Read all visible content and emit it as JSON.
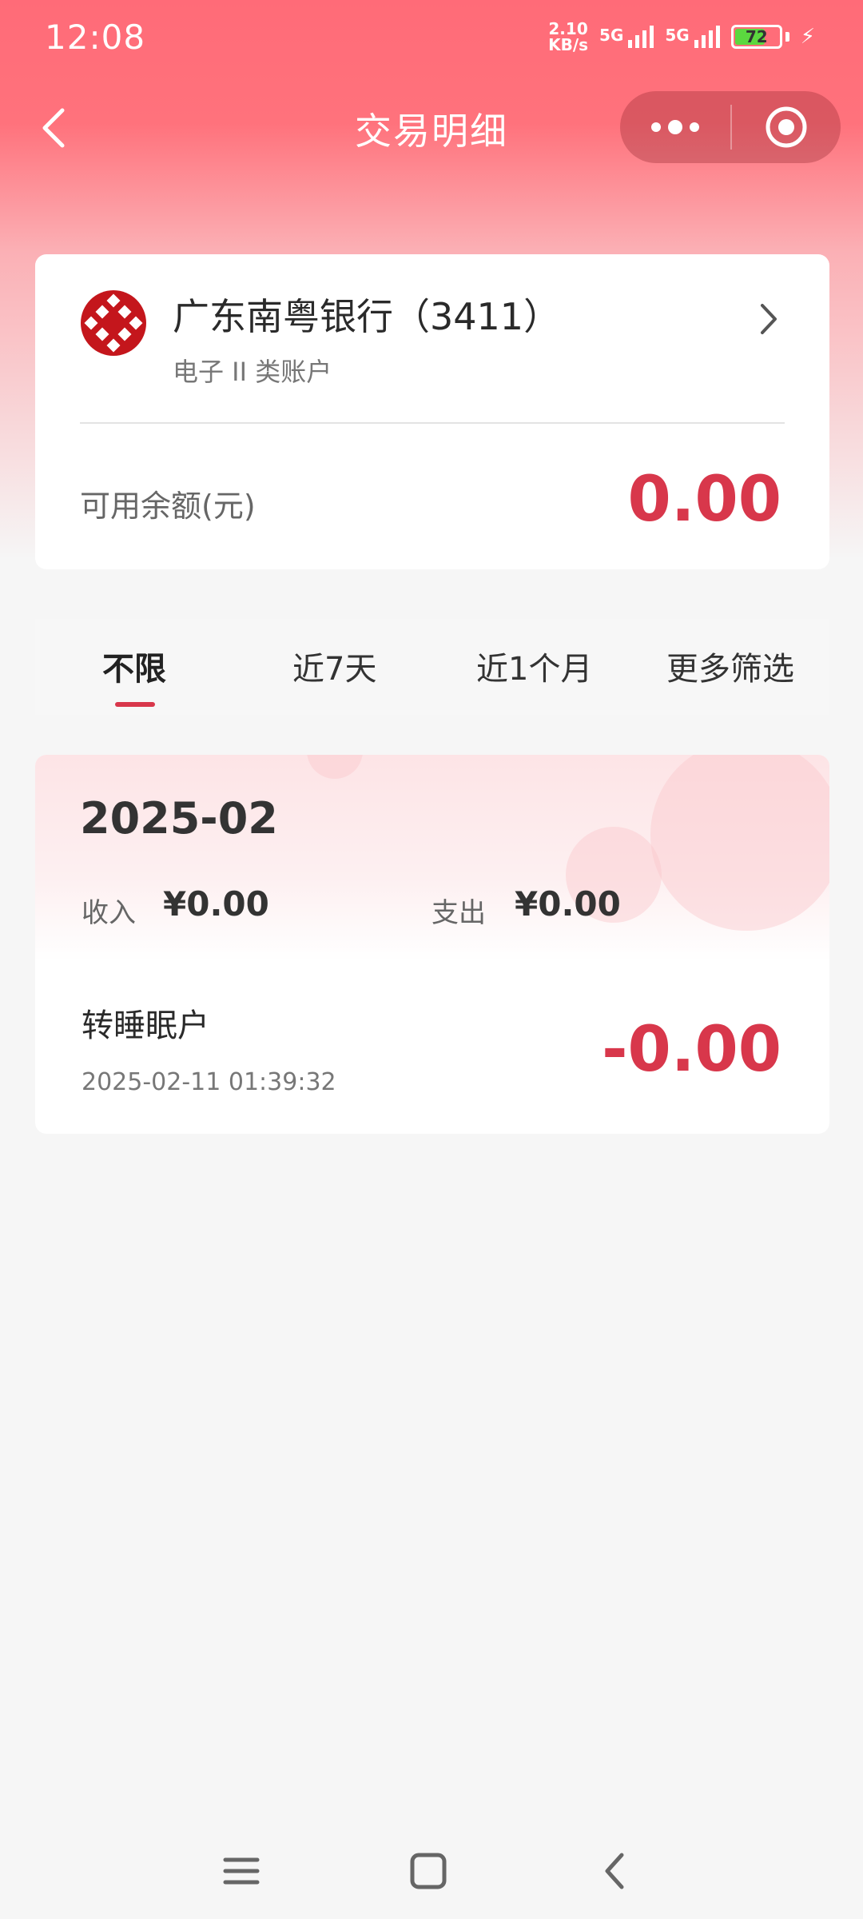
{
  "status_bar": {
    "time": "12:08",
    "net_speed_value": "2.10",
    "net_speed_unit": "KB/s",
    "signal1_label": "5G",
    "signal2_label": "5G",
    "battery_level": "72",
    "battery_fraction": 0.72
  },
  "nav": {
    "title": "交易明细",
    "back_icon": "chevron-left-icon",
    "more_icon": "more-dots-icon",
    "close_icon": "target-close-icon"
  },
  "account": {
    "bank_name": "广东南粤银行（3411）",
    "account_type": "电子 II 类账户",
    "balance_label": "可用余额(元)",
    "balance_value": "0.00"
  },
  "filters": {
    "tabs": [
      {
        "label": "不限",
        "active": true
      },
      {
        "label": "近7天",
        "active": false
      },
      {
        "label": "近1个月",
        "active": false
      },
      {
        "label": "更多筛选",
        "active": false
      }
    ]
  },
  "transactions": {
    "month": "2025-02",
    "income_label": "收入",
    "income_value": "¥0.00",
    "expense_label": "支出",
    "expense_value": "¥0.00",
    "items": [
      {
        "title": "转睡眠户",
        "time": "2025-02-11 01:39:32",
        "amount": "-0.00"
      }
    ]
  },
  "colors": {
    "accent": "#d8374b",
    "header_top": "#ff6b78",
    "page_bg": "#f6f6f6"
  },
  "system_nav": {
    "menu_icon": "menu-icon",
    "home_icon": "home-square-icon",
    "back_icon": "back-triangle-icon"
  }
}
